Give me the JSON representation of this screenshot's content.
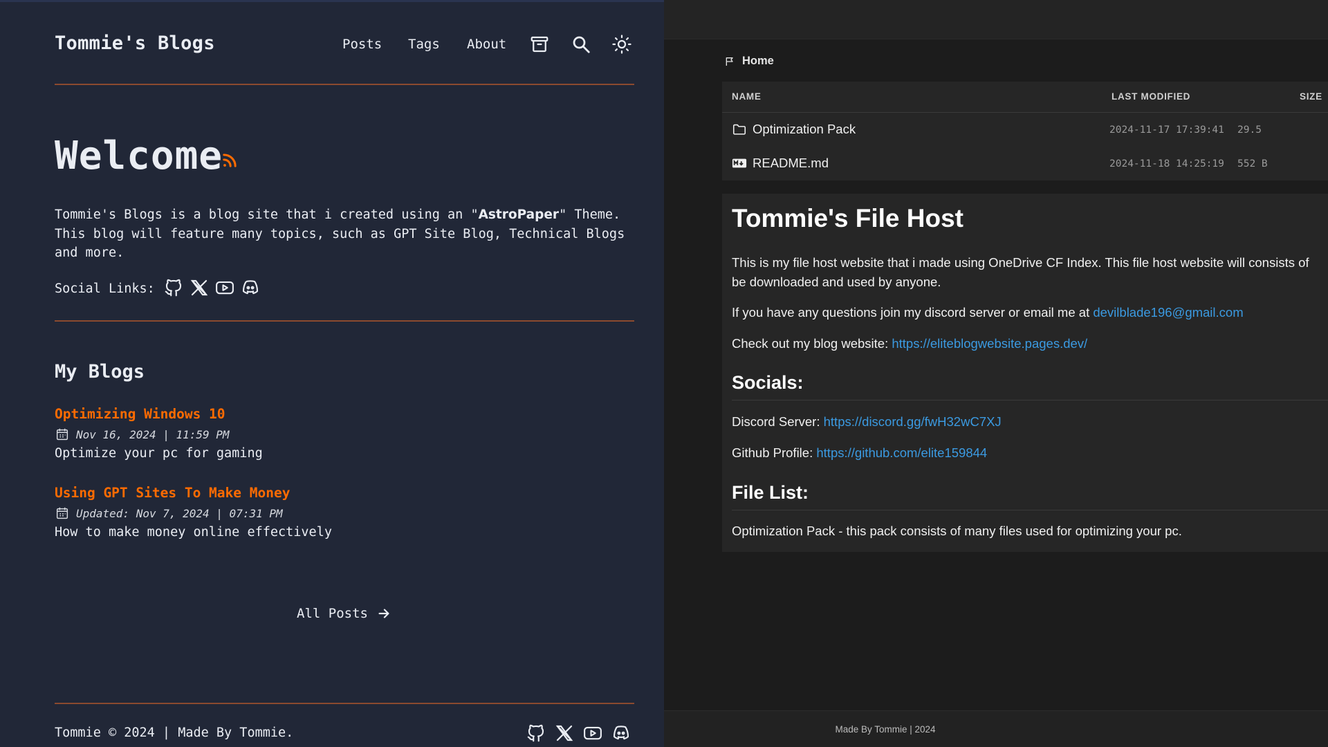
{
  "blog": {
    "site_title": "Tommie's Blogs",
    "nav": [
      "Posts",
      "Tags",
      "About"
    ],
    "nav_icons": [
      "archive-icon",
      "search-icon",
      "theme-toggle-icon"
    ],
    "welcome": "Welcome",
    "intro_before": "Tommie's Blogs is a blog site that i created using an \"",
    "intro_bold": "AstroPaper",
    "intro_after": "\" Theme.\nThis blog will feature many topics, such as GPT Site Blog, Technical Blogs\nand more.",
    "social_label": "Social Links:",
    "social_icons": [
      "github-icon",
      "x-icon",
      "youtube-icon",
      "discord-icon"
    ],
    "my_blogs_heading": "My Blogs",
    "posts": [
      {
        "title": "Optimizing Windows 10",
        "date": "Nov 16, 2024 | 11:59 PM",
        "description": "Optimize your pc for gaming"
      },
      {
        "title": "Using GPT Sites To Make Money",
        "date": "Updated: Nov 7, 2024 | 07:31 PM",
        "description": "How to make money online effectively"
      }
    ],
    "all_posts": "All Posts",
    "footer": "Tommie © 2024 | Made By Tommie.",
    "accent_color": "#ff6b01",
    "background_color": "#212737"
  },
  "filehost": {
    "breadcrumb": "Home",
    "table": {
      "headers": [
        "NAME",
        "LAST MODIFIED",
        "SIZE"
      ],
      "rows": [
        {
          "name": "Optimization Pack",
          "icon": "folder-icon",
          "modified": "2024-11-17 17:39:41",
          "size": "29.5"
        },
        {
          "name": "README.md",
          "icon": "markdown-icon",
          "modified": "2024-11-18 14:25:19",
          "size": "552 B"
        }
      ]
    },
    "readme": {
      "title": "Tommie's File Host",
      "p1_line1": "This is my file host website that i made using OneDrive CF Index. This file host website will consists of",
      "p1_line2": "be downloaded and used by anyone.",
      "p2_text": "If you have any questions join my discord server or email me at ",
      "p2_link": "devilblade196@gmail.com",
      "p3_text": "Check out my blog website: ",
      "p3_link": "https://eliteblogwebsite.pages.dev/",
      "socials_heading": "Socials:",
      "discord_label": "Discord Server: ",
      "discord_link": "https://discord.gg/fwH32wC7XJ",
      "github_label": "Github Profile: ",
      "github_link": "https://github.com/elite159844",
      "filelist_heading": "File List:",
      "filelist_item": "Optimization Pack - this pack consists of many files used for optimizing your pc."
    },
    "footer": "Made By Tommie | 2024",
    "link_color": "#3b9ae1"
  }
}
